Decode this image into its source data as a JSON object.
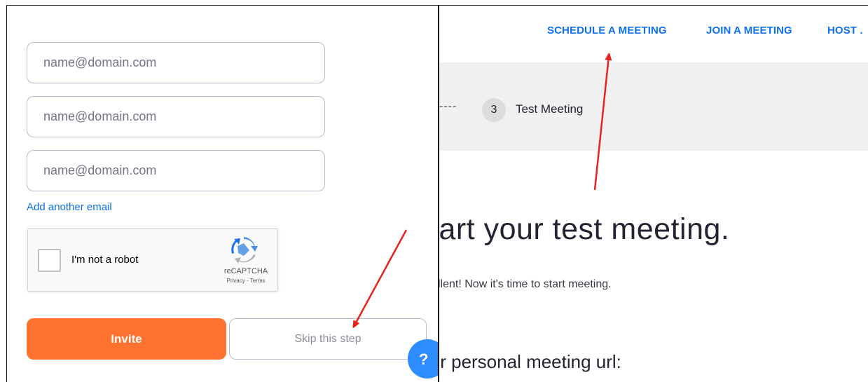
{
  "left": {
    "email_fields": [
      {
        "placeholder": "name@domain.com",
        "value": ""
      },
      {
        "placeholder": "name@domain.com",
        "value": ""
      },
      {
        "placeholder": "name@domain.com",
        "value": ""
      }
    ],
    "add_email_label": "Add another email",
    "recaptcha": {
      "label": "I'm not a robot",
      "brand": "reCAPTCHA",
      "links": "Privacy - Terms"
    },
    "invite_label": "Invite",
    "skip_label": "Skip this step",
    "help_icon": "help-icon"
  },
  "right": {
    "nav": {
      "schedule": "SCHEDULE A MEETING",
      "join": "JOIN A MEETING",
      "host": "HOST ."
    },
    "stepper": {
      "dashes": "----",
      "step_number": "3",
      "step_label": "Test Meeting"
    },
    "heading": ":art your test meeting.",
    "subtext": "llent! Now it's time to start meeting.",
    "url_heading": "ır personal meeting url:"
  },
  "colors": {
    "accent_blue": "#0e71eb",
    "invite_orange": "#ff7230",
    "annotation_red": "#e8231f",
    "stepper_bg": "#f0f0f0"
  }
}
